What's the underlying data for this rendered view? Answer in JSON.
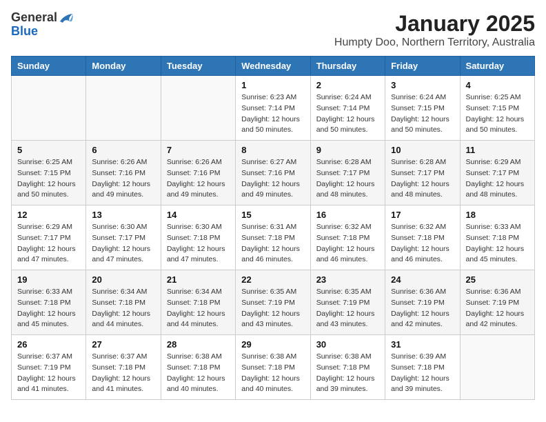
{
  "header": {
    "logo_general": "General",
    "logo_blue": "Blue",
    "title": "January 2025",
    "subtitle": "Humpty Doo, Northern Territory, Australia"
  },
  "weekdays": [
    "Sunday",
    "Monday",
    "Tuesday",
    "Wednesday",
    "Thursday",
    "Friday",
    "Saturday"
  ],
  "rows": [
    {
      "shade": false,
      "cells": [
        {
          "empty": true
        },
        {
          "empty": true
        },
        {
          "empty": true
        },
        {
          "day": "1",
          "sunrise": "6:23 AM",
          "sunset": "7:14 PM",
          "daylight": "12 hours and 50 minutes."
        },
        {
          "day": "2",
          "sunrise": "6:24 AM",
          "sunset": "7:14 PM",
          "daylight": "12 hours and 50 minutes."
        },
        {
          "day": "3",
          "sunrise": "6:24 AM",
          "sunset": "7:15 PM",
          "daylight": "12 hours and 50 minutes."
        },
        {
          "day": "4",
          "sunrise": "6:25 AM",
          "sunset": "7:15 PM",
          "daylight": "12 hours and 50 minutes."
        }
      ]
    },
    {
      "shade": true,
      "cells": [
        {
          "day": "5",
          "sunrise": "6:25 AM",
          "sunset": "7:15 PM",
          "daylight": "12 hours and 50 minutes."
        },
        {
          "day": "6",
          "sunrise": "6:26 AM",
          "sunset": "7:16 PM",
          "daylight": "12 hours and 49 minutes."
        },
        {
          "day": "7",
          "sunrise": "6:26 AM",
          "sunset": "7:16 PM",
          "daylight": "12 hours and 49 minutes."
        },
        {
          "day": "8",
          "sunrise": "6:27 AM",
          "sunset": "7:16 PM",
          "daylight": "12 hours and 49 minutes."
        },
        {
          "day": "9",
          "sunrise": "6:28 AM",
          "sunset": "7:17 PM",
          "daylight": "12 hours and 48 minutes."
        },
        {
          "day": "10",
          "sunrise": "6:28 AM",
          "sunset": "7:17 PM",
          "daylight": "12 hours and 48 minutes."
        },
        {
          "day": "11",
          "sunrise": "6:29 AM",
          "sunset": "7:17 PM",
          "daylight": "12 hours and 48 minutes."
        }
      ]
    },
    {
      "shade": false,
      "cells": [
        {
          "day": "12",
          "sunrise": "6:29 AM",
          "sunset": "7:17 PM",
          "daylight": "12 hours and 47 minutes."
        },
        {
          "day": "13",
          "sunrise": "6:30 AM",
          "sunset": "7:17 PM",
          "daylight": "12 hours and 47 minutes."
        },
        {
          "day": "14",
          "sunrise": "6:30 AM",
          "sunset": "7:18 PM",
          "daylight": "12 hours and 47 minutes."
        },
        {
          "day": "15",
          "sunrise": "6:31 AM",
          "sunset": "7:18 PM",
          "daylight": "12 hours and 46 minutes."
        },
        {
          "day": "16",
          "sunrise": "6:32 AM",
          "sunset": "7:18 PM",
          "daylight": "12 hours and 46 minutes."
        },
        {
          "day": "17",
          "sunrise": "6:32 AM",
          "sunset": "7:18 PM",
          "daylight": "12 hours and 46 minutes."
        },
        {
          "day": "18",
          "sunrise": "6:33 AM",
          "sunset": "7:18 PM",
          "daylight": "12 hours and 45 minutes."
        }
      ]
    },
    {
      "shade": true,
      "cells": [
        {
          "day": "19",
          "sunrise": "6:33 AM",
          "sunset": "7:18 PM",
          "daylight": "12 hours and 45 minutes."
        },
        {
          "day": "20",
          "sunrise": "6:34 AM",
          "sunset": "7:18 PM",
          "daylight": "12 hours and 44 minutes."
        },
        {
          "day": "21",
          "sunrise": "6:34 AM",
          "sunset": "7:18 PM",
          "daylight": "12 hours and 44 minutes."
        },
        {
          "day": "22",
          "sunrise": "6:35 AM",
          "sunset": "7:19 PM",
          "daylight": "12 hours and 43 minutes."
        },
        {
          "day": "23",
          "sunrise": "6:35 AM",
          "sunset": "7:19 PM",
          "daylight": "12 hours and 43 minutes."
        },
        {
          "day": "24",
          "sunrise": "6:36 AM",
          "sunset": "7:19 PM",
          "daylight": "12 hours and 42 minutes."
        },
        {
          "day": "25",
          "sunrise": "6:36 AM",
          "sunset": "7:19 PM",
          "daylight": "12 hours and 42 minutes."
        }
      ]
    },
    {
      "shade": false,
      "cells": [
        {
          "day": "26",
          "sunrise": "6:37 AM",
          "sunset": "7:19 PM",
          "daylight": "12 hours and 41 minutes."
        },
        {
          "day": "27",
          "sunrise": "6:37 AM",
          "sunset": "7:18 PM",
          "daylight": "12 hours and 41 minutes."
        },
        {
          "day": "28",
          "sunrise": "6:38 AM",
          "sunset": "7:18 PM",
          "daylight": "12 hours and 40 minutes."
        },
        {
          "day": "29",
          "sunrise": "6:38 AM",
          "sunset": "7:18 PM",
          "daylight": "12 hours and 40 minutes."
        },
        {
          "day": "30",
          "sunrise": "6:38 AM",
          "sunset": "7:18 PM",
          "daylight": "12 hours and 39 minutes."
        },
        {
          "day": "31",
          "sunrise": "6:39 AM",
          "sunset": "7:18 PM",
          "daylight": "12 hours and 39 minutes."
        },
        {
          "empty": true
        }
      ]
    }
  ],
  "labels": {
    "sunrise": "Sunrise:",
    "sunset": "Sunset:",
    "daylight": "Daylight:"
  }
}
